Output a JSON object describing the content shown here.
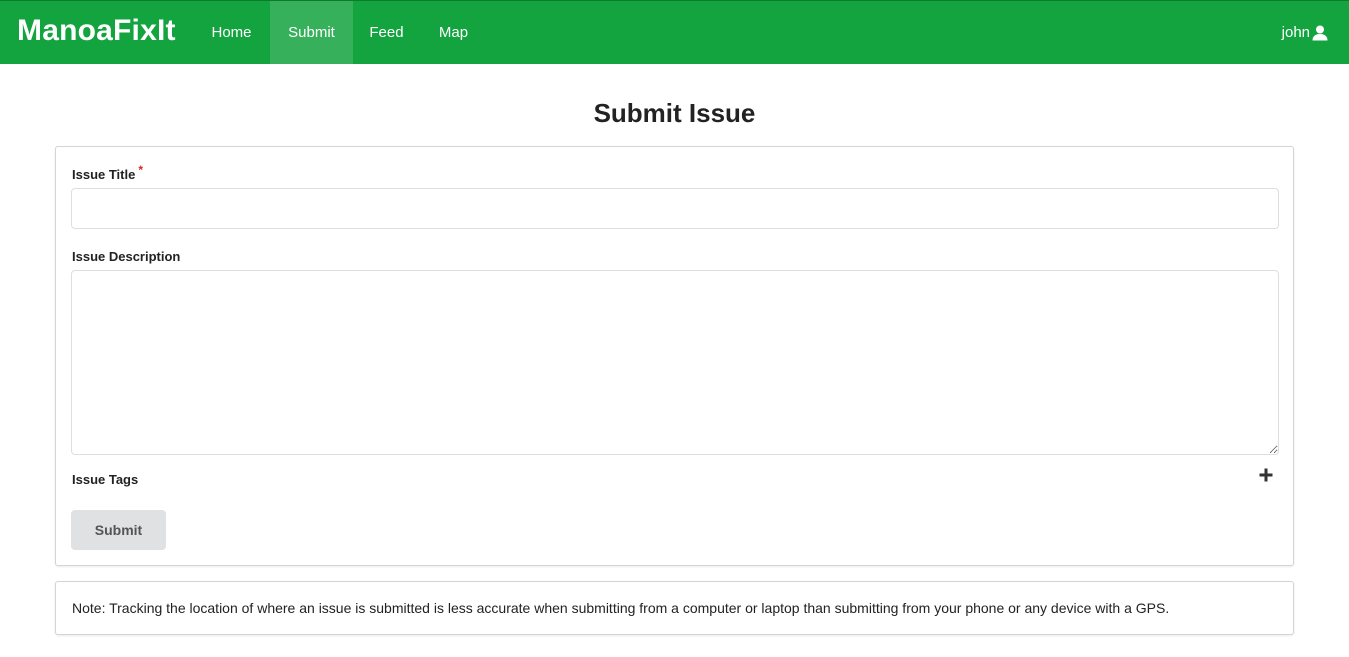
{
  "navbar": {
    "brand": "ManoaFixIt",
    "items": [
      {
        "label": "Home"
      },
      {
        "label": "Submit"
      },
      {
        "label": "Feed"
      },
      {
        "label": "Map"
      }
    ],
    "active_item": "Submit",
    "user": "john",
    "color": "#13a33f"
  },
  "page": {
    "title": "Submit Issue"
  },
  "form": {
    "title_label": "Issue Title",
    "title_required_marker": "*",
    "title_value": "",
    "description_label": "Issue Description",
    "description_value": "",
    "tags_label": "Issue Tags",
    "add_tag_icon": "plus-icon",
    "submit_label": "Submit"
  },
  "note": {
    "text": "Note: Tracking the location of where an issue is submitted is less accurate when submitting from a computer or laptop than submitting from your phone or any device with a GPS."
  }
}
